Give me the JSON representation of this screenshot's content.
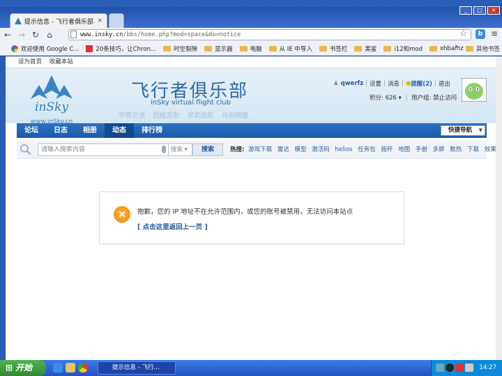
{
  "browser": {
    "tab_title": "提示信息 - 飞行者俱乐部",
    "tab_close": "×",
    "new_tab": "",
    "url_host": "www.insky.cn",
    "url_path": "/bbs/home.php?mod=space&do=notice",
    "win_min": "_",
    "win_max": "□",
    "win_close": "×"
  },
  "bookmarks": {
    "items": [
      "欢迎使用 Google C...",
      "20条技巧，让Chron...",
      "时空裂隙",
      "显示器",
      "电脑",
      "从 IE 中导入",
      "书签栏",
      "黑鲨",
      "i12和mod",
      "xhbamz"
    ],
    "more": "»",
    "other": "其他书签"
  },
  "site": {
    "top_links": [
      "设为首页",
      "收藏本站"
    ],
    "logo_text": "inSky",
    "logo_url": "www.inSky.cn",
    "club_name": "飞行者俱乐部",
    "club_sub": "inSky virtual flight club",
    "slogans": [
      "平等交流",
      "团结互助",
      "求实进取",
      "共创辉煌"
    ]
  },
  "user": {
    "name": "qwerfz",
    "links": [
      "设置",
      "消息"
    ],
    "remind": "提醒(2)",
    "logout": "退出",
    "points": "积分: 626 ▾",
    "group": "用户组: 禁止访问"
  },
  "nav": {
    "items": [
      "论坛",
      "日志",
      "相册",
      "动态",
      "排行榜"
    ],
    "active_index": 3,
    "quick_nav": "快捷导航"
  },
  "search": {
    "placeholder": "请输入搜索内容",
    "scope": "搜索 ▾",
    "button": "搜索",
    "hot_label": "热搜:",
    "hot_words": [
      "游戏下载",
      "雷达",
      "模型",
      "激活码",
      "helios",
      "任务包",
      "摇杆",
      "地图",
      "手册",
      "多屏",
      "数热",
      "下载",
      "效果"
    ]
  },
  "notice": {
    "message": "抱歉，您的 IP 地址不在允许范围内，或您的账号被禁用，无法访问本站点",
    "back_link": "[ 点击这里返回上一页 ]"
  },
  "taskbar": {
    "start": "开始",
    "task": "提示信息 - 飞行...",
    "clock": "14:27"
  },
  "colors": {
    "nav_bg": "#1c5aa8",
    "accent": "#2a5a9a",
    "warning": "#f08a00"
  }
}
